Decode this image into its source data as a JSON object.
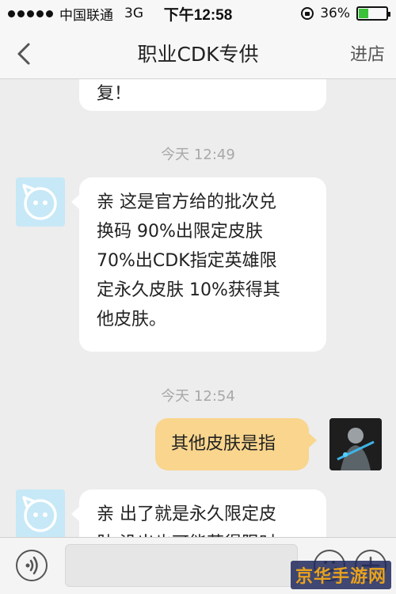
{
  "status_bar": {
    "carrier": "中国联通",
    "network": "3G",
    "time": "下午12:58",
    "battery_percent": "36%",
    "battery_level": 0.36,
    "signal_icon": "signal-dots-icon",
    "lock_icon": "rotation-lock-icon",
    "battery_icon": "battery-icon"
  },
  "nav": {
    "back_icon": "chevron-left-icon",
    "title": "职业CDK专供",
    "action": "进店"
  },
  "messages": {
    "partial_text": "复！",
    "timestamp_1": "今天 12:49",
    "msg1": {
      "line1": "亲 这是官方给的批次兑",
      "line2": "换码 90%出限定皮肤",
      "line3": "70%出CDK指定英雄限",
      "line4": "定永久皮肤 10%获得其",
      "line5": "他皮肤。"
    },
    "timestamp_2": "今天 12:54",
    "msg2_user": "其他皮肤是指",
    "msg3": {
      "line1": "亲 出了就是永久限定皮",
      "line2": "肤 没出也可能获得限时"
    }
  },
  "input_bar": {
    "voice_icon": "voice-icon",
    "emoji_icon": "emoji-smile-icon",
    "plus_icon": "plus-icon"
  },
  "watermark": "京华手游网",
  "colors": {
    "bubble_user": "#f9d58d",
    "bubble_other": "#ffffff",
    "avatar_bg": "#c6e8f7",
    "battery_green": "#3cc13a"
  }
}
